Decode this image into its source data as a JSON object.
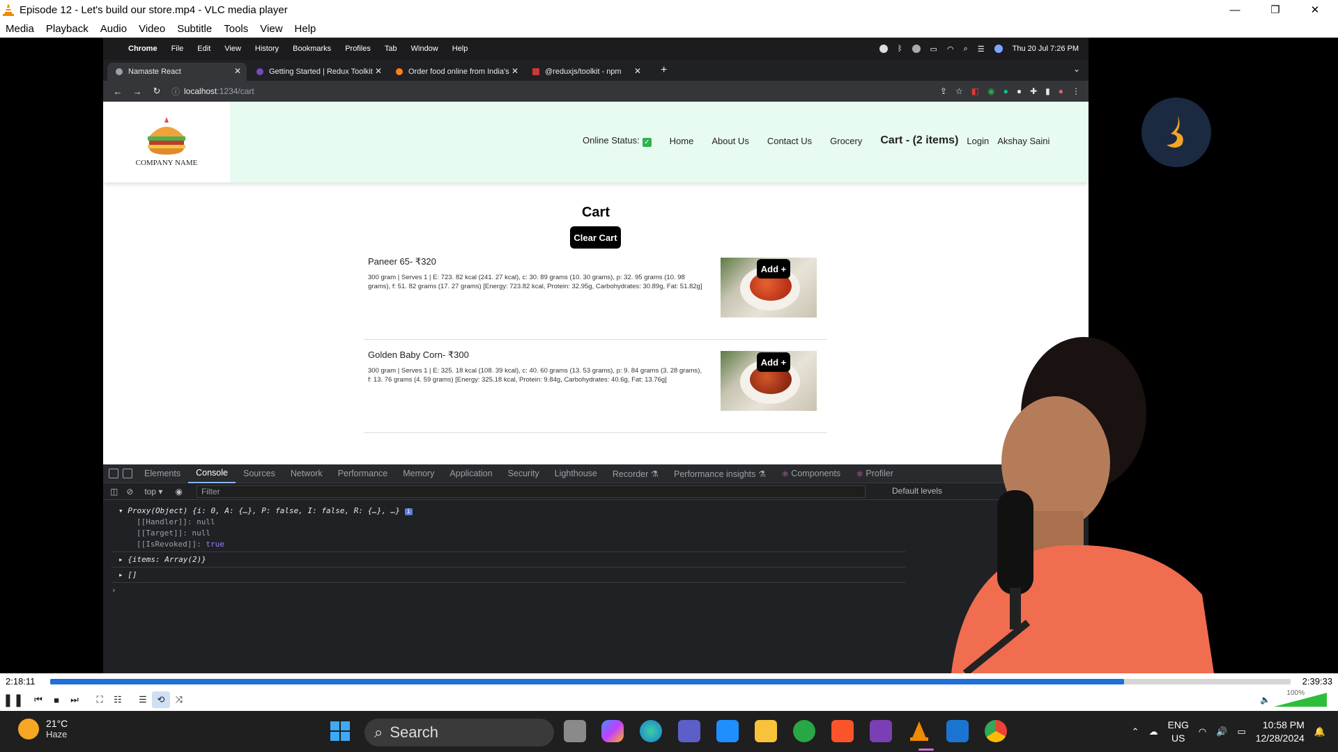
{
  "vlc": {
    "window_title": "Episode 12 - Let's build our store.mp4 - VLC media player",
    "window_controls": [
      "—",
      "❐",
      "✕"
    ],
    "menu": [
      "Media",
      "Playback",
      "Audio",
      "Video",
      "Subtitle",
      "Tools",
      "View",
      "Help"
    ],
    "time_elapsed": "2:18:11",
    "time_total": "2:39:33",
    "progress": 0.866,
    "volume_label": "100%",
    "volume": 1.0
  },
  "mac": {
    "apple": "",
    "menu": [
      "Chrome",
      "File",
      "Edit",
      "View",
      "History",
      "Bookmarks",
      "Profiles",
      "Tab",
      "Window",
      "Help"
    ],
    "datetime": "Thu 20 Jul  7:26 PM"
  },
  "chrome": {
    "tabs": [
      {
        "label": "Namaste React",
        "color": "#9aa0a6"
      },
      {
        "label": "Getting Started | Redux Toolkit",
        "color": "#764abc"
      },
      {
        "label": "Order food online from India's",
        "color": "#fc8019"
      },
      {
        "label": "@reduxjs/toolkit - npm",
        "color": "#cb3837"
      }
    ],
    "close": "✕",
    "new_tab": "+",
    "tab_menu": "⌄",
    "nav": [
      "←",
      "→",
      "↻"
    ],
    "url_host": "localhost",
    "url_path": ":1234/cart"
  },
  "site": {
    "company_name": "COMPANY NAME",
    "online_status": "Online Status:",
    "online_check": "✓",
    "nav": [
      "Home",
      "About Us",
      "Contact Us",
      "Grocery"
    ],
    "cart": "Cart - (2 items)",
    "login": "Login",
    "user": "Akshay Saini",
    "cart_title": "Cart",
    "clear_cart": "Clear Cart",
    "add_button": "Add +",
    "items": [
      {
        "name": "Paneer 65- ₹320",
        "desc": "300 gram | Serves 1 | E: 723. 82 kcal (241. 27 kcal), c: 30. 89 grams (10. 30 grams), p: 32. 95 grams (10. 98 grams), f: 51. 82 grams (17. 27 grams) [Energy: 723.82 kcal, Protein: 32.95g, Carbohydrates: 30.89g, Fat: 51.82g]"
      },
      {
        "name": "Golden Baby Corn- ₹300",
        "desc": "300 gram | Serves 1 | E: 325. 18 kcal (108. 39 kcal), c: 40. 60 grams (13. 53 grams), p: 9. 84 grams (3. 28 grams), f: 13. 76 grams (4. 59 grams) [Energy: 325.18 kcal, Protein: 9.84g, Carbohydrates: 40.6g, Fat: 13.76g]"
      }
    ]
  },
  "devtools": {
    "tabs": [
      "Elements",
      "Console",
      "Sources",
      "Network",
      "Performance",
      "Memory",
      "Application",
      "Security",
      "Lighthouse",
      "Recorder ⚗",
      "Performance insights ⚗",
      "Components",
      "Profiler"
    ],
    "active_tab": "Console",
    "context": "top",
    "filter_placeholder": "Filter",
    "levels": "Default levels",
    "lines": {
      "proxy_head": "Proxy(Object) {i: 0, A: {…}, P: false, I: false, R: {…}, …}",
      "handler": "[[Handler]]: ",
      "handler_val": "null",
      "target": "[[Target]]: ",
      "target_val": "null",
      "revoked": "[[IsRevoked]]: ",
      "revoked_val": "true",
      "items": "{items: Array(2)}",
      "empty_arr": "[]",
      "prompt": "›"
    }
  },
  "taskbar": {
    "temperature": "21°C",
    "weather": "Haze",
    "search": "Search",
    "lang_1": "ENG",
    "lang_2": "US",
    "time": "10:58 PM",
    "date": "12/28/2024",
    "icons": [
      "windows-start",
      "task-view",
      "copilot",
      "edge",
      "teams",
      "mail",
      "file-explorer",
      "xbox",
      "brave",
      "app",
      "vlc",
      "vscode",
      "chrome"
    ]
  }
}
